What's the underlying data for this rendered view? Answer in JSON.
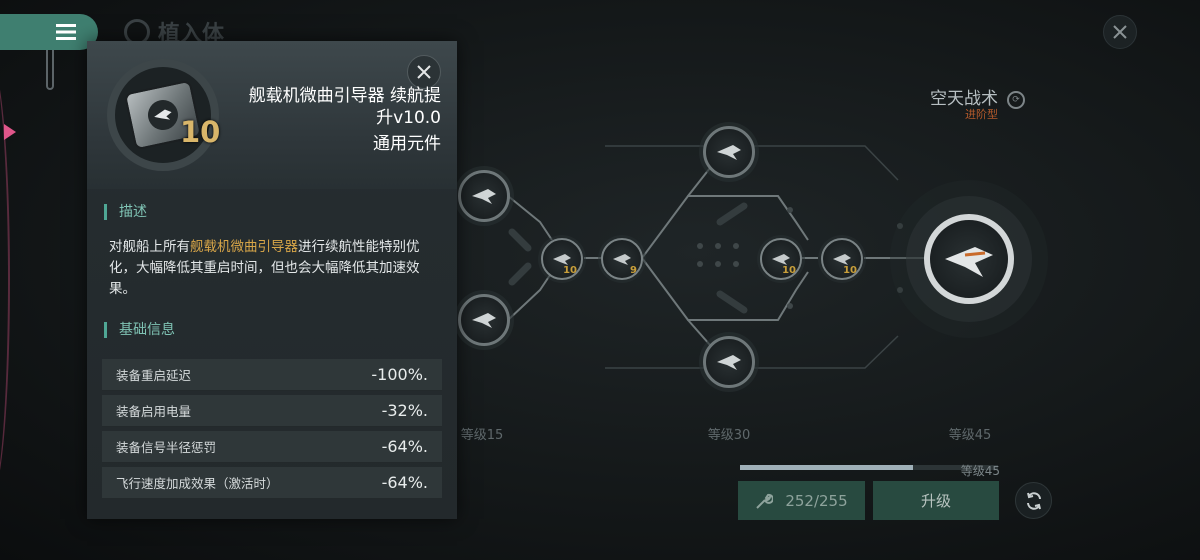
{
  "page": {
    "title": "植入体"
  },
  "skill": {
    "name": "空天战术",
    "type": "进阶型"
  },
  "popup": {
    "item_level": "10",
    "title_line1": "舰载机微曲引导器 续航提",
    "title_line2": "升v10.0",
    "category": "通用元件",
    "description_header": "描述",
    "description": {
      "prefix": "对舰船上所有",
      "highlight": "舰载机微曲引导器",
      "suffix": "进行续航性能特别优化，大幅降低其重启时间，但也会大幅降低其加速效果。"
    },
    "basic_info_header": "基础信息",
    "stats": [
      {
        "label": "装备重启延迟",
        "value": "-100%."
      },
      {
        "label": "装备启用电量",
        "value": "-32%."
      },
      {
        "label": "装备信号半径惩罚",
        "value": "-64%."
      },
      {
        "label": "飞行速度加成效果（激活时）",
        "value": "-64%."
      }
    ]
  },
  "tree": {
    "level_labels": [
      "等级15",
      "等级30",
      "等级45"
    ],
    "node_levels": [
      "10",
      "9",
      "10",
      "10"
    ]
  },
  "progress": {
    "level_label": "等级45",
    "fraction": 0.67
  },
  "buttons": {
    "resource": "252/255",
    "upgrade": "升级"
  },
  "colors": {
    "accent": "#3f7f70",
    "highlight": "#d8a648",
    "button": "#284a40",
    "level": "#c99f3a"
  }
}
